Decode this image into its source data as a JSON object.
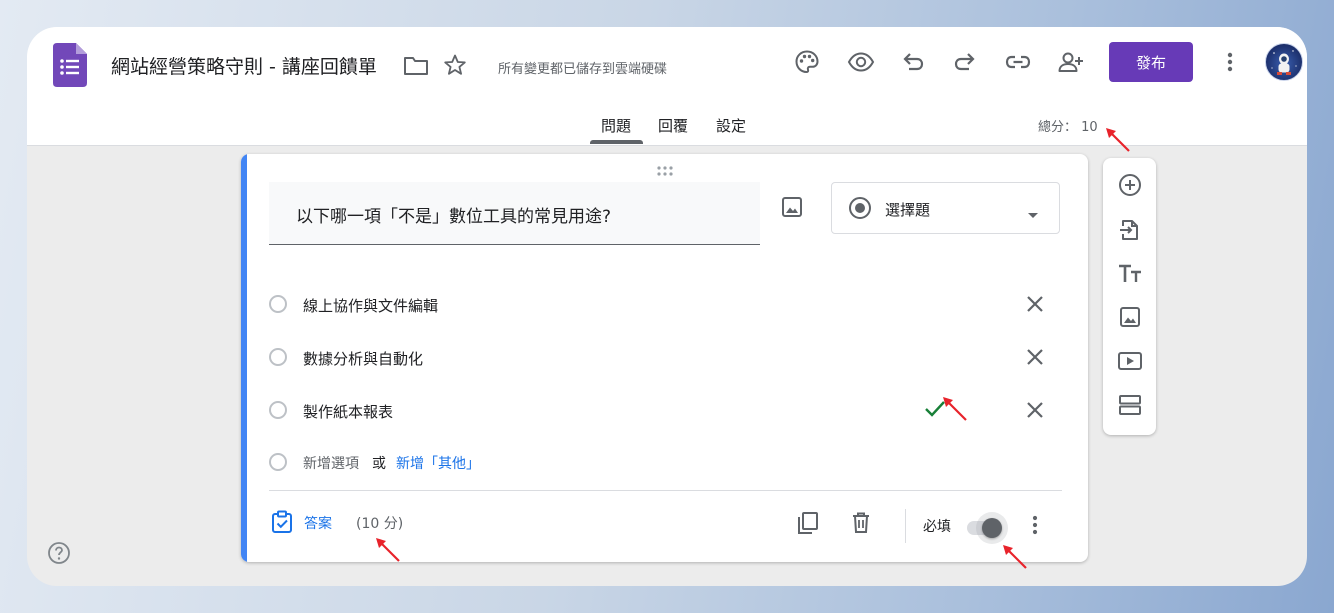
{
  "header": {
    "title": "網站經營策略守則 - 講座回饋單",
    "save_status": "所有變更都已儲存到雲端硬碟",
    "publish_label": "發布",
    "total_label": "總分： 10"
  },
  "toolbar_icons": [
    "palette-icon",
    "preview-eye-icon",
    "undo-icon",
    "redo-icon",
    "link-icon",
    "add-collaborator-icon",
    "more-vert-icon"
  ],
  "tabs": [
    {
      "label": "問題",
      "active": true
    },
    {
      "label": "回覆",
      "active": false
    },
    {
      "label": "設定",
      "active": false
    }
  ],
  "question": {
    "title": "以下哪一項「不是」數位工具的常見用途?",
    "type_label": "選擇題",
    "options": [
      {
        "label": "線上協作與文件編輯",
        "correct": false
      },
      {
        "label": "數據分析與自動化",
        "correct": false
      },
      {
        "label": "製作紙本報表",
        "correct": true
      }
    ],
    "add_option": "新增選項",
    "or": "或",
    "add_other": "新增「其他」",
    "answer_label": "答案",
    "points_label": "(10 分)",
    "required_label": "必填",
    "required": true
  },
  "side_toolbar": [
    "add-question-icon",
    "import-questions-icon",
    "add-title-icon",
    "add-image-icon",
    "add-video-icon",
    "add-section-icon"
  ],
  "colors": {
    "accent": "#673ab7",
    "card_accent": "#4285f4",
    "link_blue": "#1a73e8",
    "check_green": "#188038",
    "annotation_red": "#e8232b"
  }
}
